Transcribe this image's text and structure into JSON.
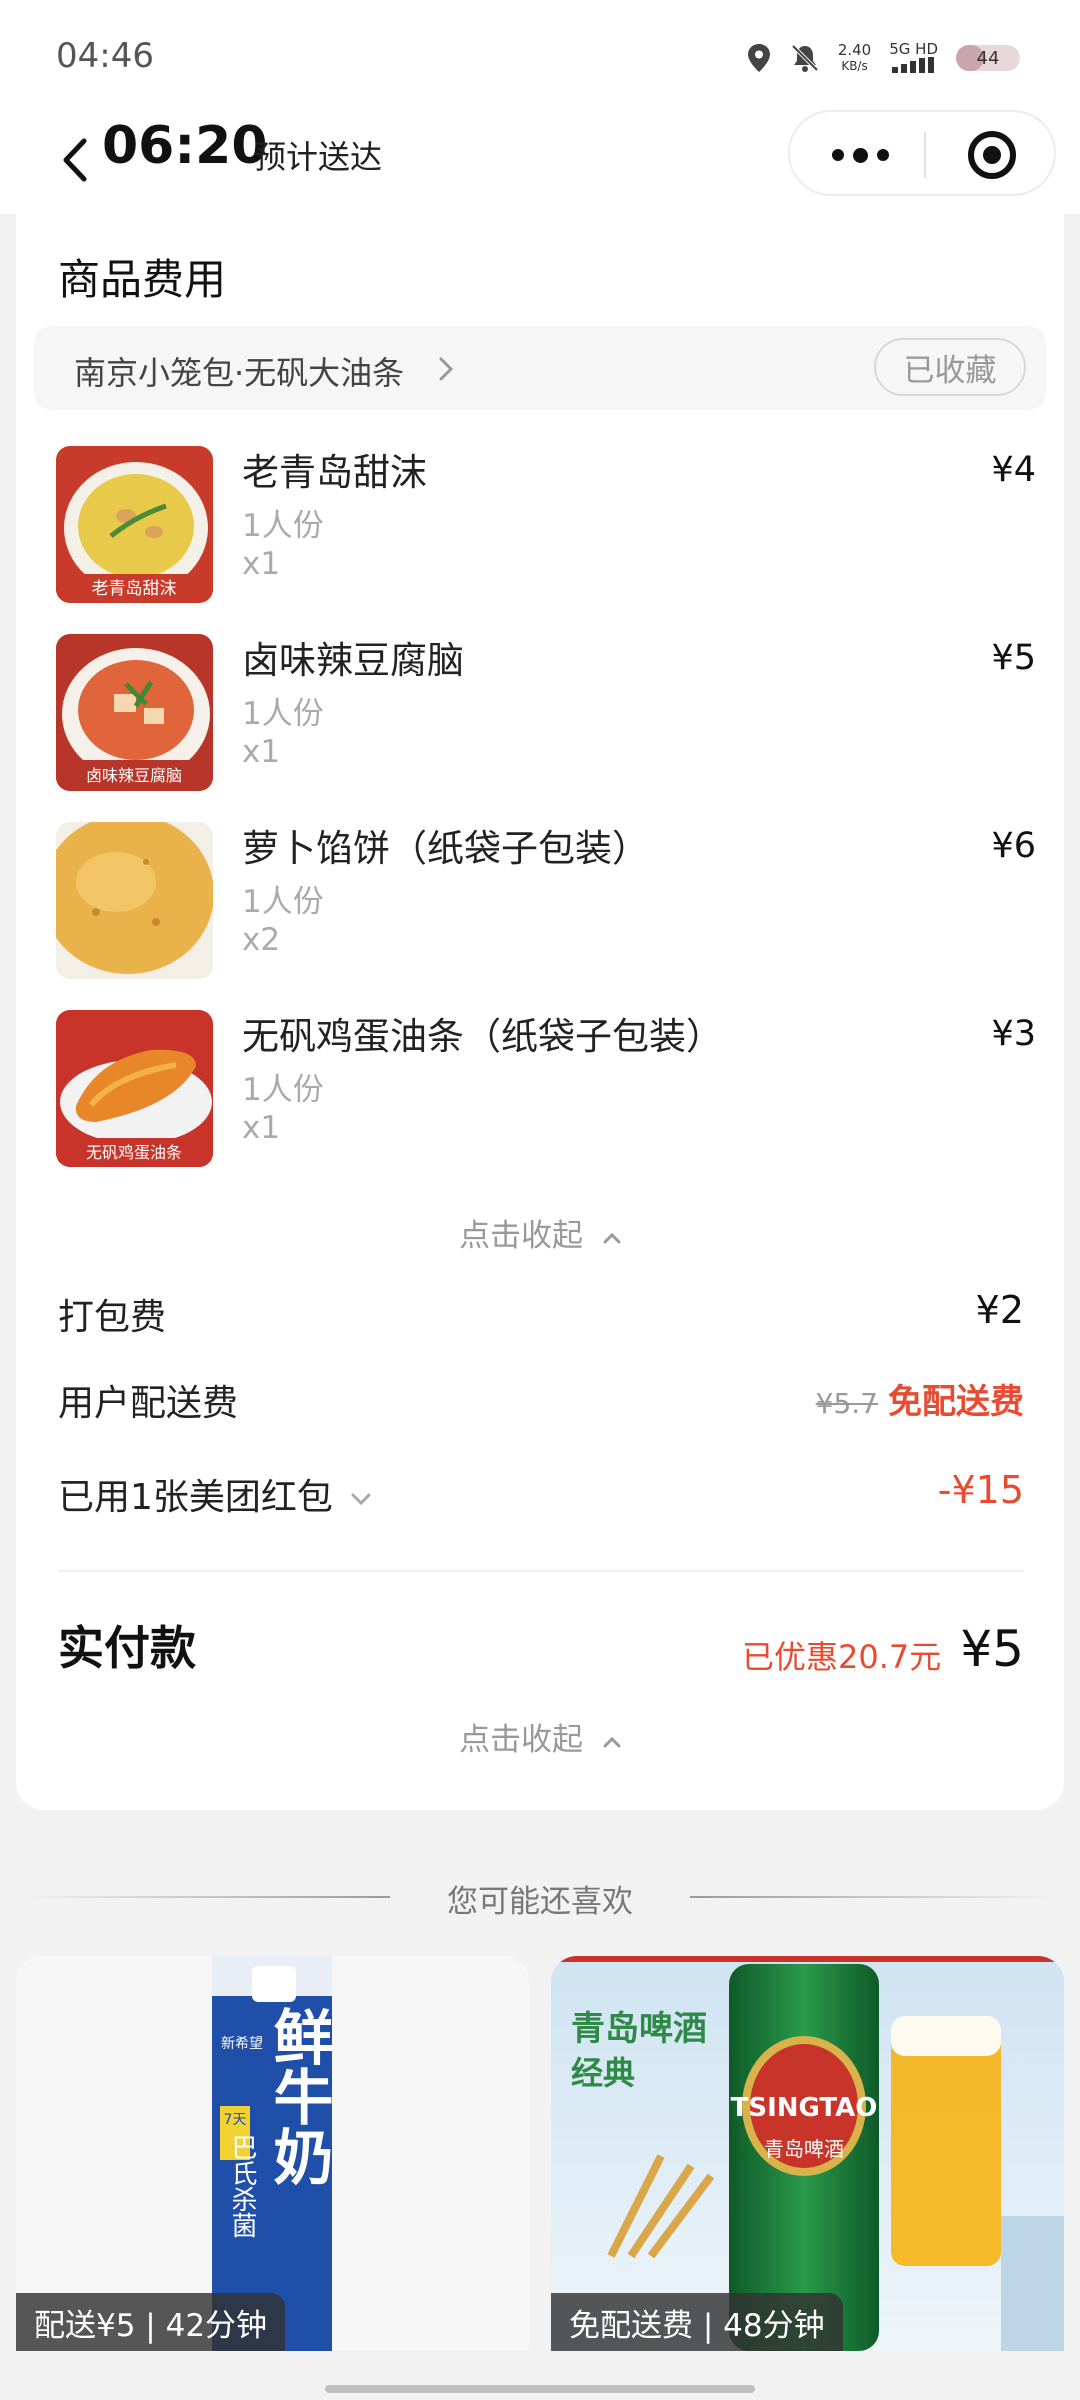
{
  "status_bar": {
    "time": "04:46",
    "net_speed_value": "2.40",
    "net_speed_unit": "KB/s",
    "network": "5G HD",
    "battery": "44",
    "battery_level": 0.44
  },
  "header": {
    "eta_time": "06:20",
    "eta_label": "预计送达"
  },
  "order": {
    "section_title": "商品费用",
    "shop_name": "南京小笼包·无矾大油条",
    "favorite_label": "已收藏",
    "items": [
      {
        "name": "老青岛甜沫",
        "spec": "1人份",
        "qty": "x1",
        "price": "¥4",
        "thumb_caption": "老青岛甜沫"
      },
      {
        "name": "卤味辣豆腐脑",
        "spec": "1人份",
        "qty": "x1",
        "price": "¥5",
        "thumb_caption": "卤味辣豆腐脑"
      },
      {
        "name": "萝卜馅饼（纸袋子包装）",
        "spec": "1人份",
        "qty": "x2",
        "price": "¥6",
        "thumb_caption": ""
      },
      {
        "name": "无矾鸡蛋油条（纸袋子包装）",
        "spec": "1人份",
        "qty": "x1",
        "price": "¥3",
        "thumb_caption": "无矾鸡蛋油条"
      }
    ],
    "collapse_label": "点击收起",
    "packing_fee_label": "打包费",
    "packing_fee_value": "¥2",
    "delivery_fee_label": "用户配送费",
    "delivery_fee_original": "¥5.7",
    "delivery_fee_value": "免配送费",
    "coupon_label": "已用1张美团红包",
    "coupon_value": "-¥15",
    "total_label": "实付款",
    "saved_text": "已优惠20.7元",
    "total_value": "¥5",
    "collapse_label_bottom": "点击收起"
  },
  "recommend": {
    "title": "您可能还喜欢",
    "cards": [
      {
        "badge": "配送¥5 | 42分钟",
        "brand": "新希望",
        "product_text": "鲜牛奶",
        "side_text": "巴氏杀菌",
        "days": "7天"
      },
      {
        "badge": "免配送费 | 48分钟",
        "brand": "青岛啤酒",
        "headline": "青岛啤酒",
        "subline": "经典",
        "can_text": "TSINGTAO",
        "can_cn": "青岛啤酒"
      }
    ]
  },
  "colors": {
    "accent_red": "#e94b32",
    "milk_blue": "#1f4fa8",
    "beer_green": "#1c7a3a"
  }
}
